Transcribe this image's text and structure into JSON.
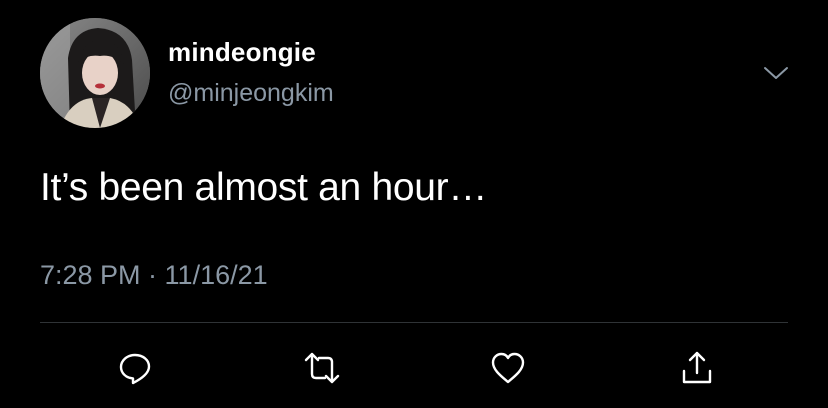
{
  "author": {
    "display_name": "mindeongie",
    "handle": "@minjeongkim"
  },
  "tweet": {
    "text": "It’s been almost an hour…",
    "timestamp": "7:28 PM · 11/16/21"
  },
  "icons": {
    "more": "chevron-down-icon",
    "reply": "reply-icon",
    "retweet": "retweet-icon",
    "like": "heart-icon",
    "share": "share-icon"
  },
  "colors": {
    "background": "#000000",
    "text": "#ffffff",
    "secondary_text": "#8b98a5",
    "divider": "#2f3336"
  }
}
